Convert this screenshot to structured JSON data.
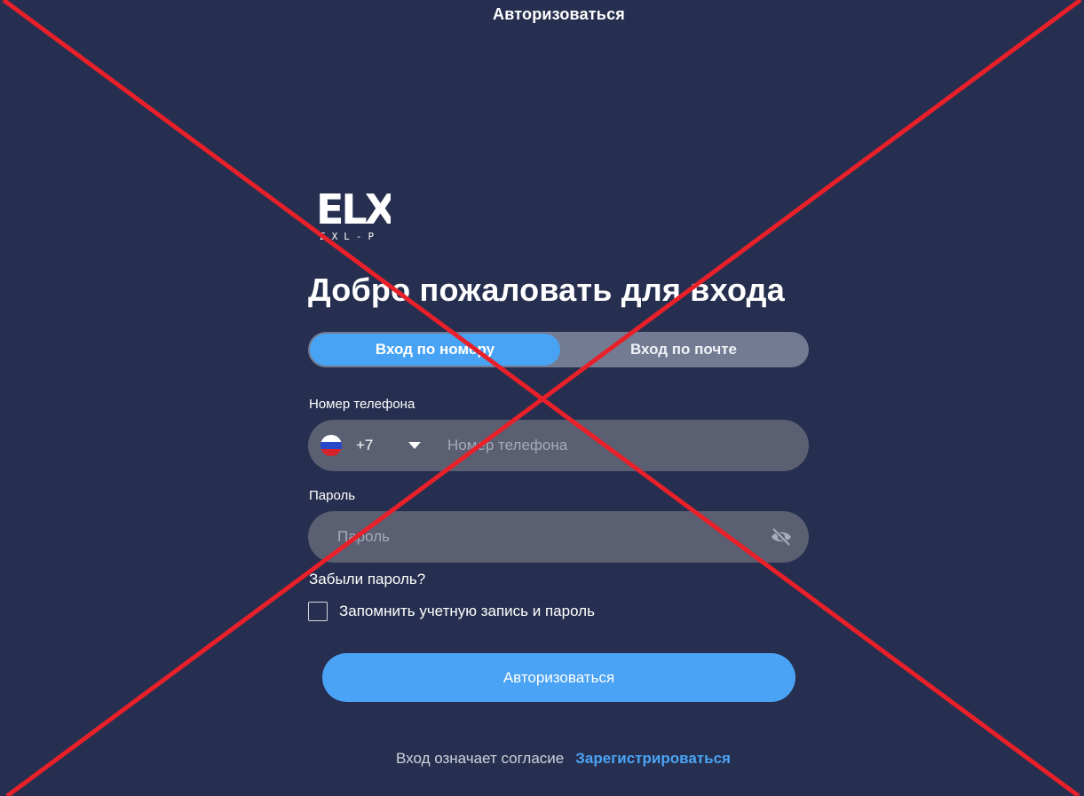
{
  "header": {
    "title": "Авторизоваться"
  },
  "brand": {
    "logo_text": "ELX",
    "logo_subtext": "EXL-P"
  },
  "login": {
    "title": "Добро пожаловать для входа",
    "tabs": [
      {
        "label": "Вход по номеру",
        "active": true
      },
      {
        "label": "Вход по почте",
        "active": false
      }
    ],
    "phone": {
      "label": "Номер телефона",
      "country_code": "+7",
      "placeholder": "Номер телефона",
      "flag_icon": "russia-flag-icon"
    },
    "password": {
      "label": "Пароль",
      "placeholder": "Пароль",
      "visibility_icon": "eye-off-icon"
    },
    "forgot_password": "Забыли пароль?",
    "remember_me": {
      "label": "Запомнить учетную запись и пароль",
      "checked": false
    },
    "submit_label": "Авторизоваться"
  },
  "footer": {
    "text": "Вход означает согласие",
    "link": "Зарегистрироваться"
  },
  "colors": {
    "background": "#262f4f",
    "accent": "#4aa3f4",
    "field": "#5a5f72",
    "tab_track": "#737b93",
    "cross": "#e8202a"
  }
}
